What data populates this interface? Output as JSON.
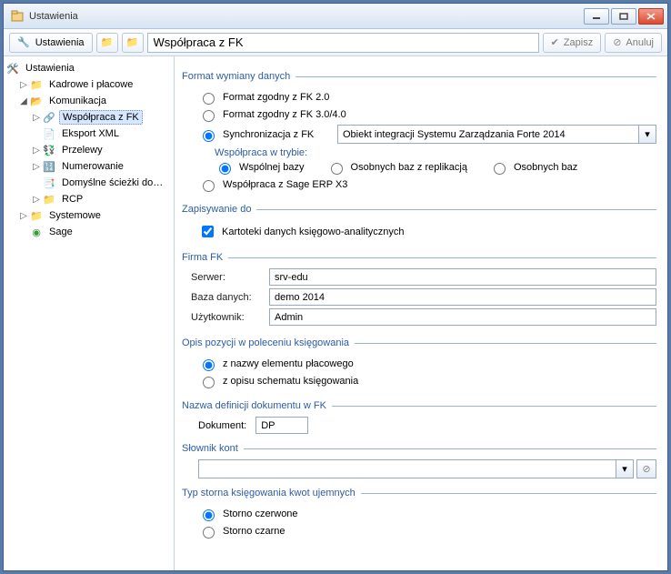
{
  "window": {
    "title": "Ustawienia"
  },
  "toolbar": {
    "label": "Ustawienia",
    "title_value": "Współpraca z FK",
    "save": "Zapisz",
    "cancel": "Anuluj"
  },
  "tree": {
    "root": "Ustawienia",
    "kadrowe": "Kadrowe i płacowe",
    "komunikacja": "Komunikacja",
    "wspolpraca_fk": "Współpraca z FK",
    "eksport_xml": "Eksport XML",
    "przelewy": "Przelewy",
    "numerowanie": "Numerowanie",
    "domyslne_sciezki": "Domyślne ścieżki do…",
    "rcp": "RCP",
    "systemowe": "Systemowe",
    "sage": "Sage"
  },
  "sections": {
    "format": {
      "legend": "Format wymiany danych",
      "opt1": "Format zgodny z FK 2.0",
      "opt2": "Format zgodny z FK 3.0/4.0",
      "opt3": "Synchronizacja z FK",
      "select_value": "Obiekt integracji Systemu Zarządzania Forte 2014",
      "sub_title": "Współpraca w trybie:",
      "sub1": "Wspólnej bazy",
      "sub2": "Osobnych baz z replikacją",
      "sub3": "Osobnych baz",
      "opt4": "Współpraca z Sage ERP X3"
    },
    "zapis": {
      "legend": "Zapisywanie do",
      "chk": "Kartoteki danych księgowo-analitycznych"
    },
    "firma": {
      "legend": "Firma FK",
      "serwer_label": "Serwer:",
      "serwer_value": "srv-edu",
      "baza_label": "Baza danych:",
      "baza_value": "demo 2014",
      "user_label": "Użytkownik:",
      "user_value": "Admin"
    },
    "opis": {
      "legend": "Opis pozycji w poleceniu księgowania",
      "opt1": "z nazwy elementu płacowego",
      "opt2": "z opisu schematu księgowania"
    },
    "nazwa": {
      "legend": "Nazwa definicji dokumentu w FK",
      "label": "Dokument:",
      "value": "DP"
    },
    "slownik": {
      "legend": "Słownik kont",
      "value": ""
    },
    "storno": {
      "legend": "Typ storna księgowania kwot ujemnych",
      "opt1": "Storno czerwone",
      "opt2": "Storno czarne"
    }
  }
}
